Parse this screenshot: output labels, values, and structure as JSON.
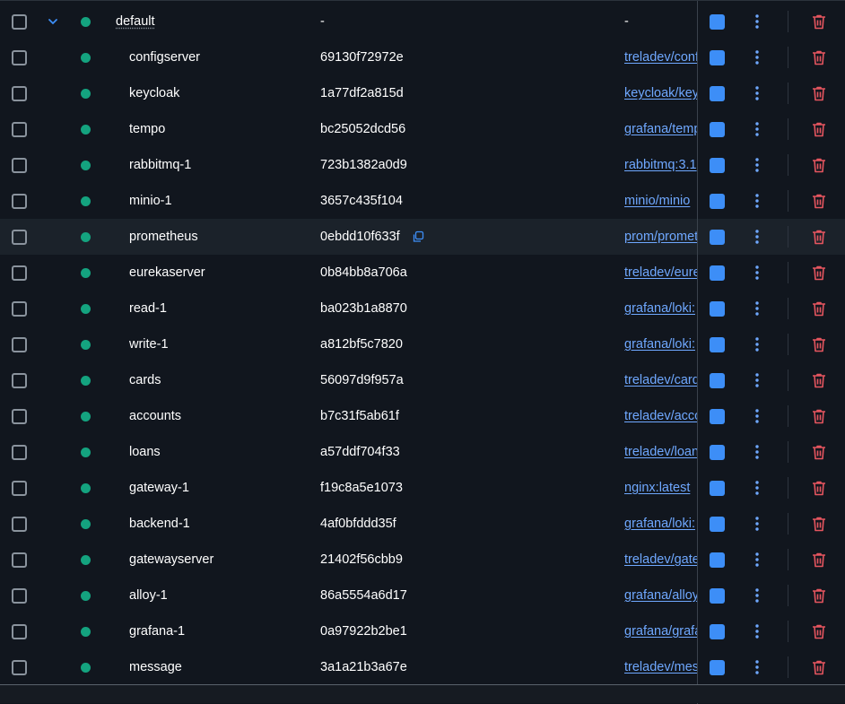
{
  "colors": {
    "background": "#11161e",
    "row_hover": "#1b222a",
    "status_running": "#14a37f",
    "link": "#6fa8ff",
    "start_button": "#3d8ef7",
    "delete": "#e5555f"
  },
  "icons": {
    "expand": "chevron-down-icon",
    "status": "status-dot-icon",
    "copy": "copy-icon",
    "start": "start-button",
    "more": "more-vertical-icon",
    "delete": "trash-icon"
  },
  "group": {
    "name": "default",
    "container_id": "-",
    "image": "-"
  },
  "containers": [
    {
      "name": "configserver",
      "id": "69130f72972e",
      "image": "treladev/configserver"
    },
    {
      "name": "keycloak",
      "id": "1a77df2a815d",
      "image": "keycloak/keycloak"
    },
    {
      "name": "tempo",
      "id": "bc25052dcd56",
      "image": "grafana/tempo"
    },
    {
      "name": "rabbitmq-1",
      "id": "723b1382a0d9",
      "image": "rabbitmq:3.1"
    },
    {
      "name": "minio-1",
      "id": "3657c435f104",
      "image": "minio/minio"
    },
    {
      "name": "prometheus",
      "id": "0ebdd10f633f",
      "image": "prom/prometheus"
    },
    {
      "name": "eurekaserver",
      "id": "0b84bb8a706a",
      "image": "treladev/eurekaserver"
    },
    {
      "name": "read-1",
      "id": "ba023b1a8870",
      "image": "grafana/loki:"
    },
    {
      "name": "write-1",
      "id": "a812bf5c7820",
      "image": "grafana/loki:"
    },
    {
      "name": "cards",
      "id": "56097d9f957a",
      "image": "treladev/cards"
    },
    {
      "name": "accounts",
      "id": "b7c31f5ab61f",
      "image": "treladev/accounts"
    },
    {
      "name": "loans",
      "id": "a57ddf704f33",
      "image": "treladev/loans"
    },
    {
      "name": "gateway-1",
      "id": "f19c8a5e1073",
      "image": "nginx:latest"
    },
    {
      "name": "backend-1",
      "id": "4af0bfddd35f",
      "image": "grafana/loki:"
    },
    {
      "name": "gatewayserver",
      "id": "21402f56cbb9",
      "image": "treladev/gatewayserver"
    },
    {
      "name": "alloy-1",
      "id": "86a5554a6d17",
      "image": "grafana/alloy"
    },
    {
      "name": "grafana-1",
      "id": "0a97922b2be1",
      "image": "grafana/grafana"
    },
    {
      "name": "message",
      "id": "3a1a21b3a67e",
      "image": "treladev/message"
    }
  ],
  "hovered_row": "prometheus"
}
